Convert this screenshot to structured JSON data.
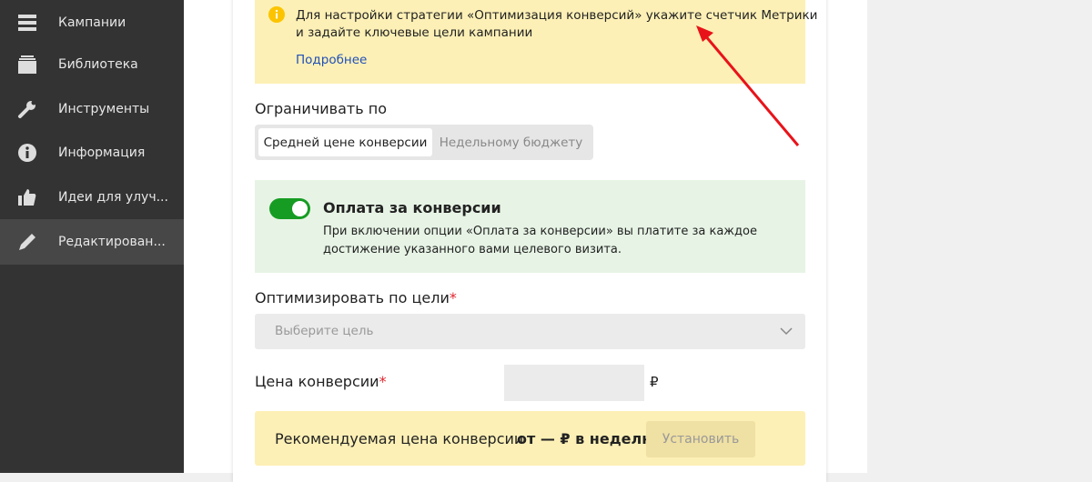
{
  "sidebar": {
    "items": [
      {
        "label": "Кампании",
        "icon": "campaigns-icon"
      },
      {
        "label": "Библиотека",
        "icon": "library-icon"
      },
      {
        "label": "Инструменты",
        "icon": "wrench-icon"
      },
      {
        "label": "Информация",
        "icon": "info-icon"
      },
      {
        "label": "Идеи для улуч...",
        "icon": "thumbs-up-icon"
      },
      {
        "label": "Редактирован...",
        "icon": "pencil-icon",
        "active": true
      }
    ]
  },
  "notice": {
    "text_line1": "Для настройки стратегии «Оптимизация конверсий» укажите счетчик Метрики",
    "text_line2": "и задайте ключевые цели кампании",
    "link": "Подробнее"
  },
  "limit": {
    "label": "Ограничивать по",
    "options": [
      "Средней цене конверсии",
      "Недельному бюджету"
    ],
    "selected": "Средней цене конверсии"
  },
  "pay": {
    "title": "Оплата за конверсии",
    "enabled": true,
    "desc_line1": "При включении опции «Оплата за конверсии» вы платите за каждое",
    "desc_line2": "достижение указанного вами целевого визита."
  },
  "goal": {
    "label": "Оптимизировать по цели",
    "required": "*",
    "placeholder": "Выберите цель"
  },
  "price": {
    "label": "Цена конверсии",
    "required": "*",
    "value": "",
    "currency": "₽"
  },
  "recommend": {
    "label": "Рекомендуемая цена конверсии",
    "value": "от — ₽ в неделю",
    "button": "Установить"
  },
  "colors": {
    "sidebar": "#333333",
    "toggle": "#169c23",
    "notice": "#fdf0b6",
    "green_box": "#e7f4e5",
    "arrow": "#e8131a",
    "link": "#2050b8"
  }
}
